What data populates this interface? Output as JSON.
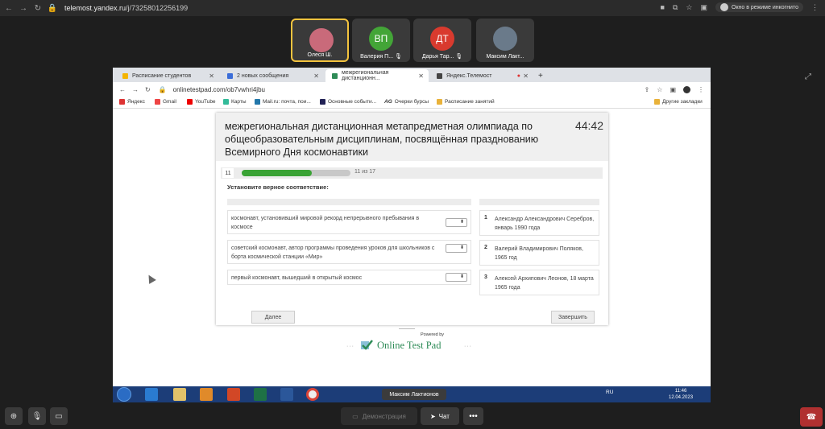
{
  "outer_browser": {
    "url_host": "telemost.yandex.ru",
    "url_path": "/j/73258012256199",
    "incognito_label": "Окно в режиме инкогнито"
  },
  "participants": [
    {
      "name": "Олеся Ш.",
      "initials": "",
      "color": "#c96a7a"
    },
    {
      "name": "Валерия П...",
      "initials": "ВП",
      "color": "#43a537"
    },
    {
      "name": "Дарья Тар...",
      "initials": "ДТ",
      "color": "#d93a2e"
    },
    {
      "name": "Максим Лакт...",
      "initials": "",
      "color": "#6a7a8a"
    }
  ],
  "inner_tabs": [
    {
      "label": "Расписание студентов",
      "color": "#f4b400"
    },
    {
      "label": "2 новых сообщения",
      "color": "#3b6dd8"
    },
    {
      "label": "межрегиональная дистанционн...",
      "color": "#2e8b57"
    },
    {
      "label": "Яндекс.Телемост",
      "color": "#444"
    }
  ],
  "inner_url": "onlinetestpad.com/ob7vwhri4jbu",
  "bookmarks": [
    {
      "label": "Яндекс",
      "color": "#d33"
    },
    {
      "label": "Gmail",
      "color": "#e44"
    },
    {
      "label": "YouTube",
      "color": "#e00"
    },
    {
      "label": "Карты",
      "color": "#3b9"
    },
    {
      "label": "Mail.ru: почта, пои...",
      "color": "#27a"
    },
    {
      "label": "Основные событи...",
      "color": "#225"
    },
    {
      "label": "Очерки бурсы",
      "color": "#555"
    },
    {
      "label": "Расписание занятий",
      "color": "#e9b23a"
    },
    {
      "label": "Другие закладки",
      "color": "#e9b23a"
    }
  ],
  "quiz": {
    "title": "межрегиональная дистанционная метапредметная олимпиада по общеобразовательным дисциплинам, посвящённая празднованию Всемирного Дня космонавтики",
    "timer": "44:42",
    "question_number": "11",
    "progress_text": "11 из 17",
    "progress_fraction": 0.647,
    "instruction": "Установите верное соответствие:",
    "left_items": [
      "космонавт, установивший мировой рекорд непрерывного пребывания в космосе",
      "советский космонавт, автор программы проведения уроков для школьников с борта космической станции «Мир»",
      "первый космонавт, вышедший в открытый космос"
    ],
    "right_items": [
      {
        "num": "1",
        "text": "Александр Александрович Серебров, январь 1990 года"
      },
      {
        "num": "2",
        "text": "Валерий Владимирович Поляков, 1965 год"
      },
      {
        "num": "3",
        "text": "Алексей Архипович Леонов, 18 марта 1965 года"
      }
    ],
    "next_label": "Далее",
    "finish_label": "Завершить"
  },
  "powered": {
    "line1": "Powered by",
    "line2": "Online Test Pad"
  },
  "taskbar": {
    "window_name": "Максим Лактионов",
    "lang": "RU",
    "time": "11:46",
    "date": "12.04.2023"
  },
  "controls": {
    "demo_label": "Демонстрация",
    "chat_label": "Чат"
  }
}
